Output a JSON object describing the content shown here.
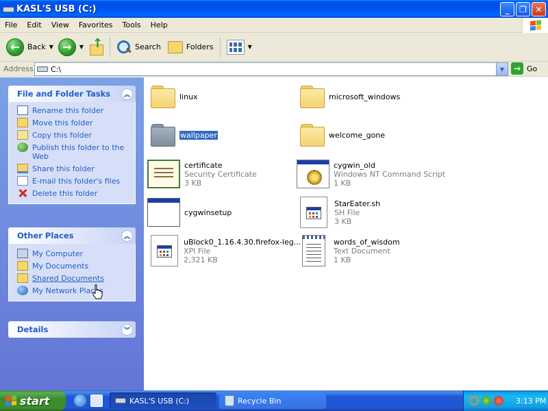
{
  "window": {
    "title": "KASL'S USB (C:)",
    "controls": {
      "minimize": "_",
      "maximize": "❐",
      "close": "✕"
    }
  },
  "menu": [
    "File",
    "Edit",
    "View",
    "Favorites",
    "Tools",
    "Help"
  ],
  "toolbar": {
    "back_label": "Back",
    "search_label": "Search",
    "folders_label": "Folders"
  },
  "address": {
    "label": "Address",
    "value": "C:\\",
    "go_label": "Go"
  },
  "left_pane": {
    "file_tasks": {
      "title": "File and Folder Tasks",
      "items": [
        {
          "label": "Rename this folder",
          "icon": "rename-icon"
        },
        {
          "label": "Move this folder",
          "icon": "move-icon"
        },
        {
          "label": "Copy this folder",
          "icon": "copy-icon"
        },
        {
          "label": "Publish this folder to the Web",
          "icon": "publish-web-icon"
        },
        {
          "label": "Share this folder",
          "icon": "share-icon"
        },
        {
          "label": "E-mail this folder's files",
          "icon": "email-icon"
        },
        {
          "label": "Delete this folder",
          "icon": "delete-icon"
        }
      ]
    },
    "other_places": {
      "title": "Other Places",
      "items": [
        {
          "label": "My Computer",
          "icon": "my-computer-icon"
        },
        {
          "label": "My Documents",
          "icon": "my-documents-icon"
        },
        {
          "label": "Shared Documents",
          "icon": "shared-documents-icon"
        },
        {
          "label": "My Network Places",
          "icon": "network-places-icon"
        }
      ]
    },
    "details": {
      "title": "Details"
    }
  },
  "files": [
    {
      "name": "linux",
      "type": "",
      "size": "",
      "icon": "folder-icon"
    },
    {
      "name": "microsoft_windows",
      "type": "",
      "size": "",
      "icon": "folder-icon"
    },
    {
      "name": "wallpaper",
      "type": "",
      "size": "",
      "icon": "folder-icon",
      "selected": true
    },
    {
      "name": "welcome_gone",
      "type": "",
      "size": "",
      "icon": "folder-icon"
    },
    {
      "name": "certificate",
      "type": "Security Certificate",
      "size": "3 KB",
      "icon": "certificate-icon"
    },
    {
      "name": "cygwin_old",
      "type": "Windows NT Command Script",
      "size": "1 KB",
      "icon": "command-script-icon"
    },
    {
      "name": "cygwinsetup",
      "type": "",
      "size": "",
      "icon": "application-icon"
    },
    {
      "name": "StarEater.sh",
      "type": "SH File",
      "size": "3 KB",
      "icon": "sh-file-icon"
    },
    {
      "name": "uBlock0_1.16.4.30.firefox-leg...",
      "type": "XPI File",
      "size": "2,321 KB",
      "icon": "xpi-file-icon"
    },
    {
      "name": "words_of_wisdom",
      "type": "Text Document",
      "size": "1 KB",
      "icon": "text-document-icon"
    }
  ],
  "taskbar": {
    "start_label": "start",
    "tasks": [
      {
        "label": "KASL'S USB (C:)",
        "active": true
      },
      {
        "label": "Recycle Bin",
        "active": false
      }
    ],
    "clock": "3:13 PM"
  },
  "colors": {
    "titlebar": "#0054e3",
    "taskpane": "#7ba2e7",
    "link": "#215dc6",
    "selection": "#316ac5",
    "start": "#3c8d2e"
  }
}
